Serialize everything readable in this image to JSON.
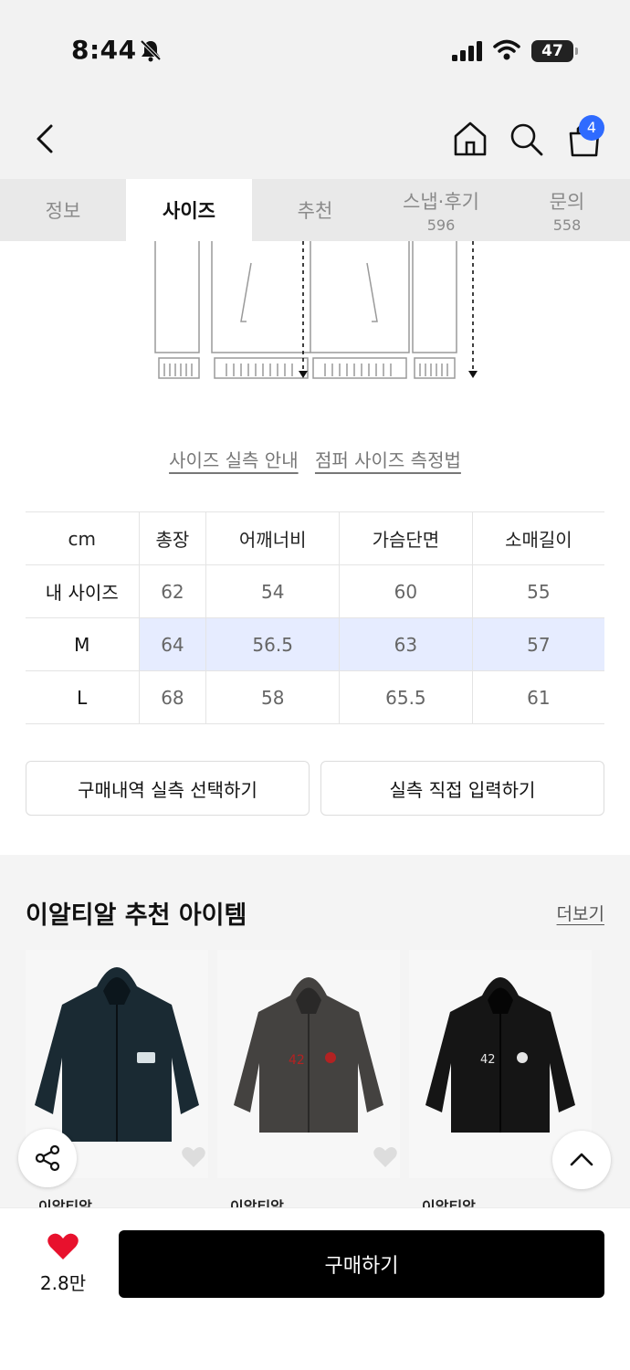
{
  "status_bar": {
    "time": "8:44",
    "battery": "47"
  },
  "header": {
    "cart_count": "4"
  },
  "tabs": [
    {
      "label": "정보",
      "count": ""
    },
    {
      "label": "사이즈",
      "count": ""
    },
    {
      "label": "추천",
      "count": ""
    },
    {
      "label": "스냅·후기",
      "count": "596"
    },
    {
      "label": "문의",
      "count": "558"
    }
  ],
  "guide_links": {
    "size_guide": "사이즈 실측 안내",
    "measure_guide": "점퍼 사이즈 측정법"
  },
  "size_table": {
    "headers": [
      "cm",
      "총장",
      "어깨너비",
      "가슴단면",
      "소매길이"
    ],
    "rows": [
      {
        "label": "내 사이즈",
        "values": [
          "62",
          "54",
          "60",
          "55"
        ]
      },
      {
        "label": "M",
        "values": [
          "64",
          "56.5",
          "63",
          "57"
        ]
      },
      {
        "label": "L",
        "values": [
          "68",
          "58",
          "65.5",
          "61"
        ]
      }
    ]
  },
  "buttons": {
    "purchase_history": "구매내역 실측 선택하기",
    "manual_input": "실측 직접 입력하기"
  },
  "recommended": {
    "title": "이알티알 추천 아이템",
    "more": "더보기",
    "products": [
      {
        "brand": "이알티알"
      },
      {
        "brand": "이알티알"
      },
      {
        "brand": "이알티알"
      }
    ]
  },
  "bottom_bar": {
    "like_count": "2.8만",
    "buy_label": "구매하기"
  },
  "colors": {
    "accent_blue": "#2f6bff",
    "highlight_row": "#e6ecff",
    "heart_red": "#e8112d"
  }
}
